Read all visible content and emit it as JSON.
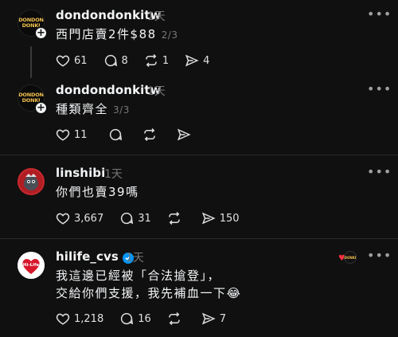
{
  "posts": [
    {
      "username": "dondondonkitw",
      "time": "1天",
      "text": "西門店賣2件$88",
      "counter": "2/3",
      "likes": "61",
      "comments": "8",
      "reposts": "1",
      "shares": "4",
      "avatar_text": "DONDON\nDONKI"
    },
    {
      "username": "dondondonkitw",
      "time": "1天",
      "text": "種類齊全",
      "counter": "3/3",
      "likes": "11",
      "comments": "",
      "reposts": "",
      "shares": "",
      "avatar_text": "DONDON\nDONKI"
    },
    {
      "username": "linshibi",
      "time": "1天",
      "text": "你們也賣39嗎",
      "likes": "3,667",
      "comments": "31",
      "reposts": "",
      "shares": "150"
    },
    {
      "username": "hilife_cvs",
      "time": "1天",
      "text_line1": "我這邊已經被「合法搶登」，",
      "text_line2": "交給你們支援，我先補血一下😂",
      "likes": "1,218",
      "comments": "16",
      "reposts": "",
      "shares": "7",
      "avatar_text": "Hi-Life"
    }
  ],
  "more_icon": "•••",
  "plus_icon": "+",
  "colors": {
    "background": "#101010",
    "text": "#f3f5f7",
    "muted": "#777777",
    "verified": "#0095f6",
    "hilife_red": "#d7182a"
  }
}
